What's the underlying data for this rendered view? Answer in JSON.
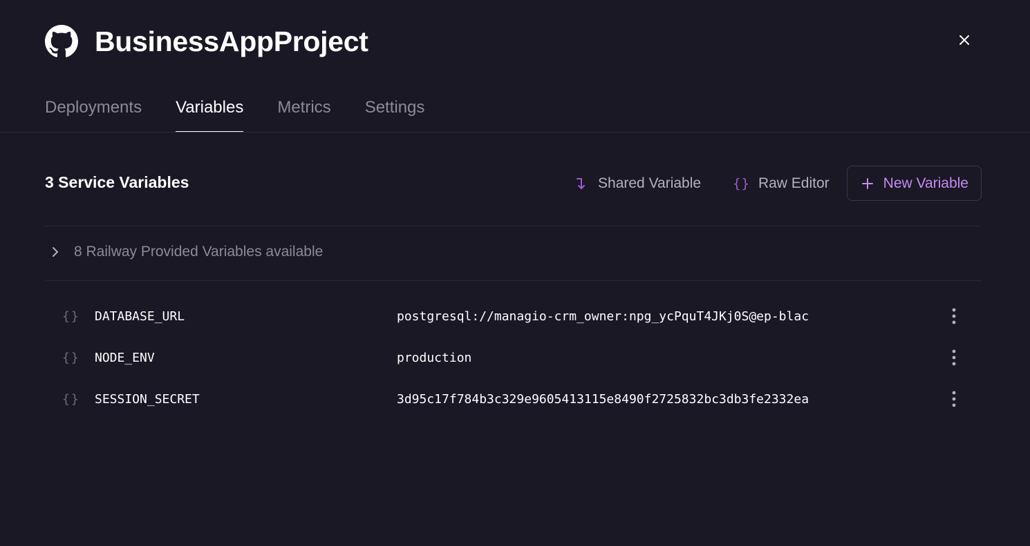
{
  "header": {
    "icon": "github-icon",
    "title": "BusinessAppProject",
    "close_icon": "close-icon"
  },
  "tabs": [
    {
      "label": "Deployments",
      "active": false
    },
    {
      "label": "Variables",
      "active": true
    },
    {
      "label": "Metrics",
      "active": false
    },
    {
      "label": "Settings",
      "active": false
    }
  ],
  "toolbar": {
    "count_label": "3 Service Variables",
    "shared_label": "Shared Variable",
    "shared_icon": "shared-variable-icon",
    "raw_label": "Raw Editor",
    "raw_icon": "braces-icon",
    "raw_icon_glyph": "{}",
    "new_label": "New Variable",
    "new_icon": "plus-icon"
  },
  "provided": {
    "label": "8 Railway Provided Variables available",
    "icon": "chevron-right-icon"
  },
  "variables": [
    {
      "name": "DATABASE_URL",
      "value": "postgresql://managio-crm_owner:npg_ycPquT4JKj0S@ep-blac"
    },
    {
      "name": "NODE_ENV",
      "value": "production"
    },
    {
      "name": "SESSION_SECRET",
      "value": "3d95c17f784b3c329e9605413115e8490f2725832bc3db3fe2332ea"
    }
  ],
  "variable_icon_glyph": "{}",
  "colors": {
    "background": "#1a1824",
    "accent": "#9b59d8",
    "accent_light": "#c48bf5",
    "muted_text": "#8d8a98"
  }
}
